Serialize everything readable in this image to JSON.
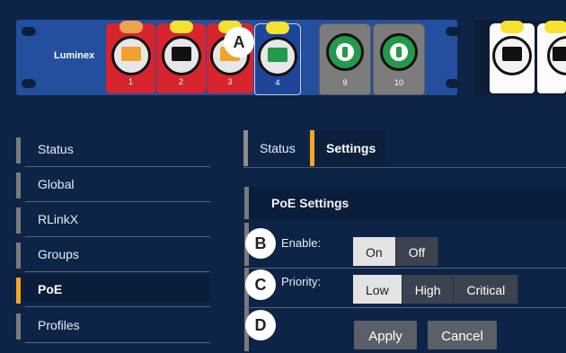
{
  "device": {
    "brand": "Luminex",
    "ports": [
      {
        "num": "1",
        "color": "red",
        "tab": "orange",
        "jack": "orange"
      },
      {
        "num": "2",
        "color": "red",
        "tab": "yellow",
        "jack": "black"
      },
      {
        "num": "3",
        "color": "red",
        "tab": "yellow",
        "jack": "orange"
      },
      {
        "num": "4",
        "color": "blue",
        "tab": "yellow",
        "jack": "green"
      },
      {
        "num": "9",
        "color": "gray",
        "tab": "",
        "jack": "green-round"
      },
      {
        "num": "10",
        "color": "gray",
        "tab": "",
        "jack": "green-round"
      }
    ]
  },
  "callouts": {
    "a": "A",
    "b": "B",
    "c": "C",
    "d": "D"
  },
  "sidebar": {
    "items": [
      {
        "label": "Status",
        "active": false
      },
      {
        "label": "Global",
        "active": false
      },
      {
        "label": "RLinkX",
        "active": false
      },
      {
        "label": "Groups",
        "active": false
      },
      {
        "label": "PoE",
        "active": true
      },
      {
        "label": "Profiles",
        "active": false
      }
    ]
  },
  "tabs": {
    "status": "Status",
    "settings": "Settings"
  },
  "section": {
    "title": "PoE Settings"
  },
  "form": {
    "enable": {
      "label": "Enable:",
      "options": [
        "On",
        "Off"
      ],
      "selected": "On"
    },
    "priority": {
      "label": "Priority:",
      "options": [
        "Low",
        "High",
        "Critical"
      ],
      "selected": "Low"
    },
    "apply": "Apply",
    "cancel": "Cancel"
  },
  "colors": {
    "accent": "#f5a623",
    "background": "#0d2447",
    "strip": "#244f9e",
    "red_port": "#d6252f"
  }
}
